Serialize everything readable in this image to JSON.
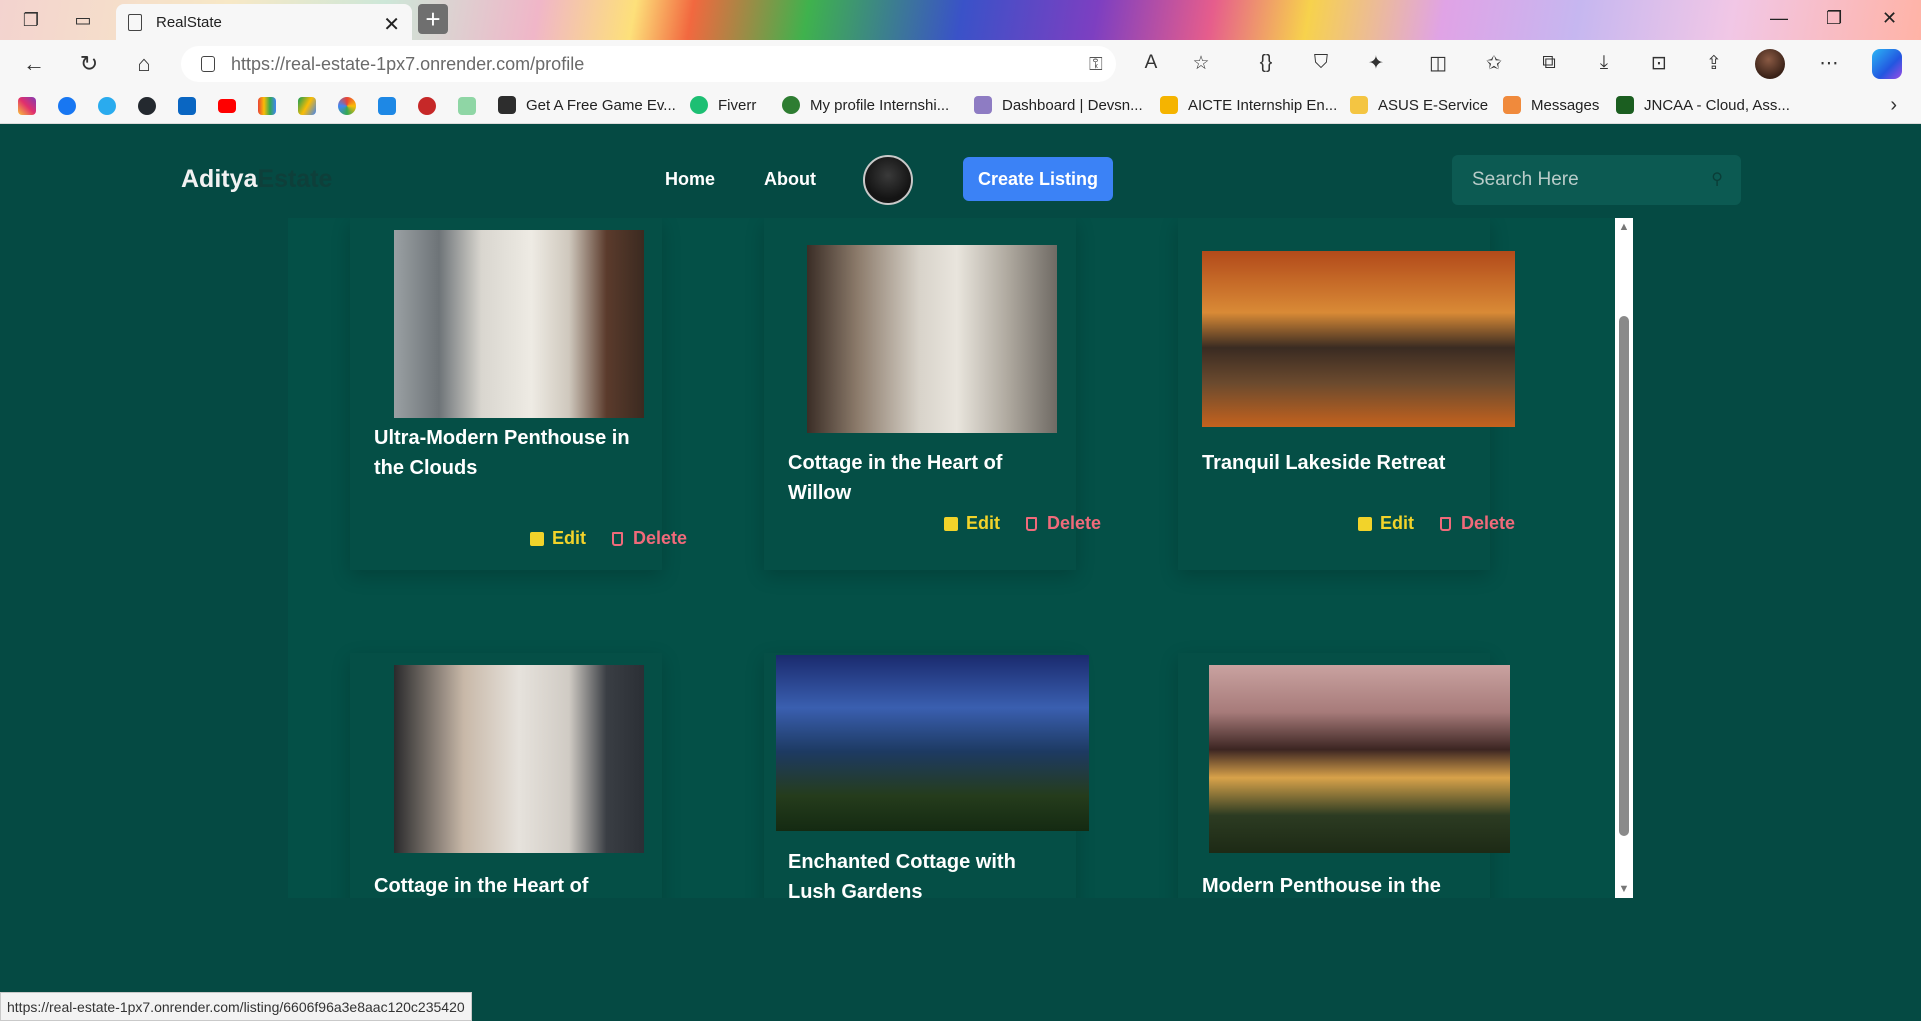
{
  "browser": {
    "tab_title": "RealState",
    "url_host": "https://real-estate-1px7.onrender.com",
    "url_path": "/profile",
    "bookmarks": [
      "Get A Free Game Ev...",
      "Fiverr",
      "My profile Internshi...",
      "Dashboard | Devsn...",
      "AICTE Internship En...",
      "ASUS E-Service",
      "Messages",
      "JNCAA - Cloud, Ass..."
    ],
    "status_url": "https://real-estate-1px7.onrender.com/listing/6606f96a3e8aac120c235420"
  },
  "site": {
    "brand_first": "Aditya",
    "brand_second": "Estate",
    "nav": {
      "home": "Home",
      "about": "About"
    },
    "create_label": "Create Listing",
    "search_placeholder": "Search Here"
  },
  "actions": {
    "edit": "Edit",
    "delete": "Delete"
  },
  "listings": [
    {
      "title": "Ultra-Modern Penthouse in the Clouds"
    },
    {
      "title": "Cottage in the Heart of Willow"
    },
    {
      "title": "Tranquil Lakeside Retreat"
    },
    {
      "title": "Cottage in the Heart of Willow"
    },
    {
      "title": "Enchanted Cottage with Lush Gardens"
    },
    {
      "title": "Modern Penthouse in the Clouds"
    }
  ],
  "colors": {
    "page_bg": "#054a43",
    "accent_button": "#3b82f6",
    "edit": "#f2d32a",
    "delete": "#f06a7a"
  }
}
